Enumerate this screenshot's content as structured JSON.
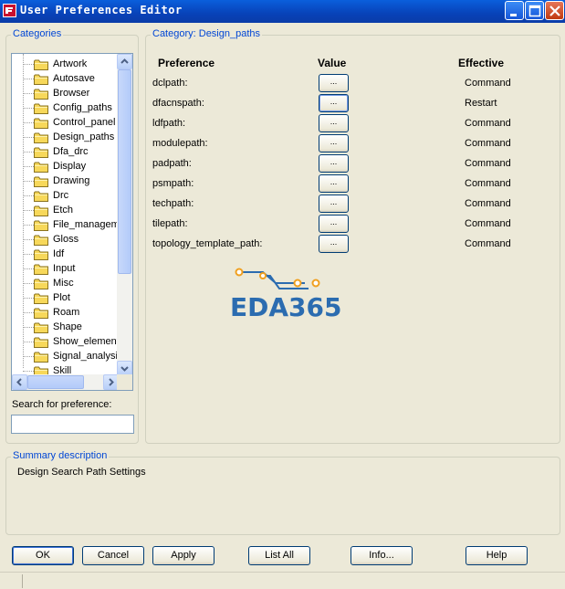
{
  "window": {
    "title": "User Preferences Editor"
  },
  "categories": {
    "legend": "Categories",
    "items": [
      "Artwork",
      "Autosave",
      "Browser",
      "Config_paths",
      "Control_panel",
      "Design_paths",
      "Dfa_drc",
      "Display",
      "Drawing",
      "Drc",
      "Etch",
      "File_management",
      "Gloss",
      "Idf",
      "Input",
      "Misc",
      "Plot",
      "Roam",
      "Shape",
      "Show_elements",
      "Signal_analysis",
      "Skill"
    ],
    "search_label": "Search for preference:",
    "search_value": ""
  },
  "category_panel": {
    "legend": "Category:  Design_paths",
    "headers": {
      "preference": "Preference",
      "value": "Value",
      "effective": "Effective"
    },
    "rows": [
      {
        "preference": "dclpath:",
        "value_button": "...",
        "effective": "Command"
      },
      {
        "preference": "dfacnspath:",
        "value_button": "...",
        "effective": "Restart"
      },
      {
        "preference": "ldfpath:",
        "value_button": "...",
        "effective": "Command"
      },
      {
        "preference": "modulepath:",
        "value_button": "...",
        "effective": "Command"
      },
      {
        "preference": "padpath:",
        "value_button": "...",
        "effective": "Command"
      },
      {
        "preference": "psmpath:",
        "value_button": "...",
        "effective": "Command"
      },
      {
        "preference": "techpath:",
        "value_button": "...",
        "effective": "Command"
      },
      {
        "preference": "tilepath:",
        "value_button": "...",
        "effective": "Command"
      },
      {
        "preference": "topology_template_path:",
        "value_button": "...",
        "effective": "Command"
      }
    ],
    "watermark": "EDA365"
  },
  "summary": {
    "legend": "Summary description",
    "text": "Design Search Path Settings"
  },
  "buttons": {
    "ok": "OK",
    "cancel": "Cancel",
    "apply": "Apply",
    "list_all": "List All",
    "info": "Info...",
    "help": "Help"
  },
  "colors": {
    "titlebar": "#0a4fd0",
    "accent_blue": "#0046d5",
    "watermark_blue": "#2b6cb0",
    "watermark_orange": "#f0a020"
  },
  "icons": {
    "app": "app-icon",
    "folder": "folder-icon"
  }
}
